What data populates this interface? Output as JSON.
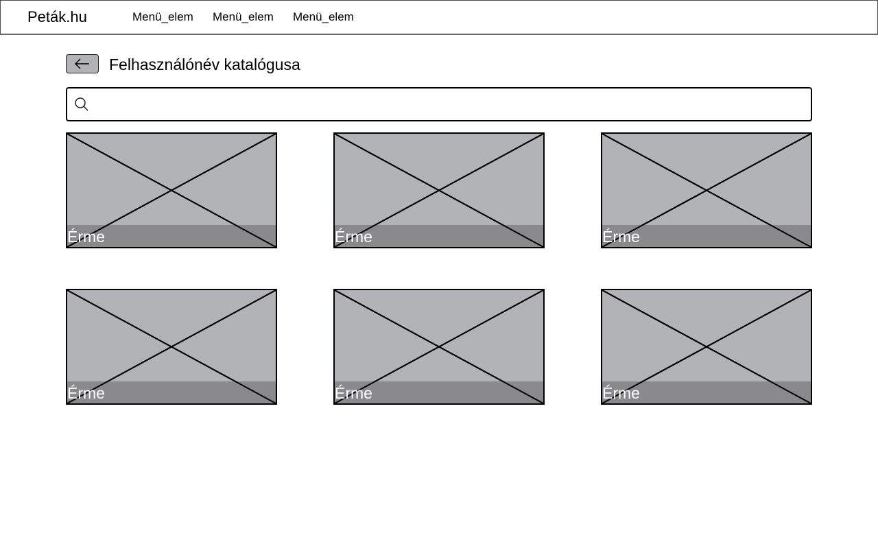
{
  "header": {
    "brand": "Peták.hu",
    "menu": [
      {
        "label": "Menü_elem"
      },
      {
        "label": "Menü_elem"
      },
      {
        "label": "Menü_elem"
      }
    ]
  },
  "page": {
    "title": "Felhasználónév katalógusa",
    "back_icon": "arrow-left-icon"
  },
  "search": {
    "icon": "search-icon",
    "value": "",
    "placeholder": ""
  },
  "catalog": {
    "items": [
      {
        "label": "Érme"
      },
      {
        "label": "Érme"
      },
      {
        "label": "Érme"
      },
      {
        "label": "Érme"
      },
      {
        "label": "Érme"
      },
      {
        "label": "Érme"
      }
    ]
  }
}
